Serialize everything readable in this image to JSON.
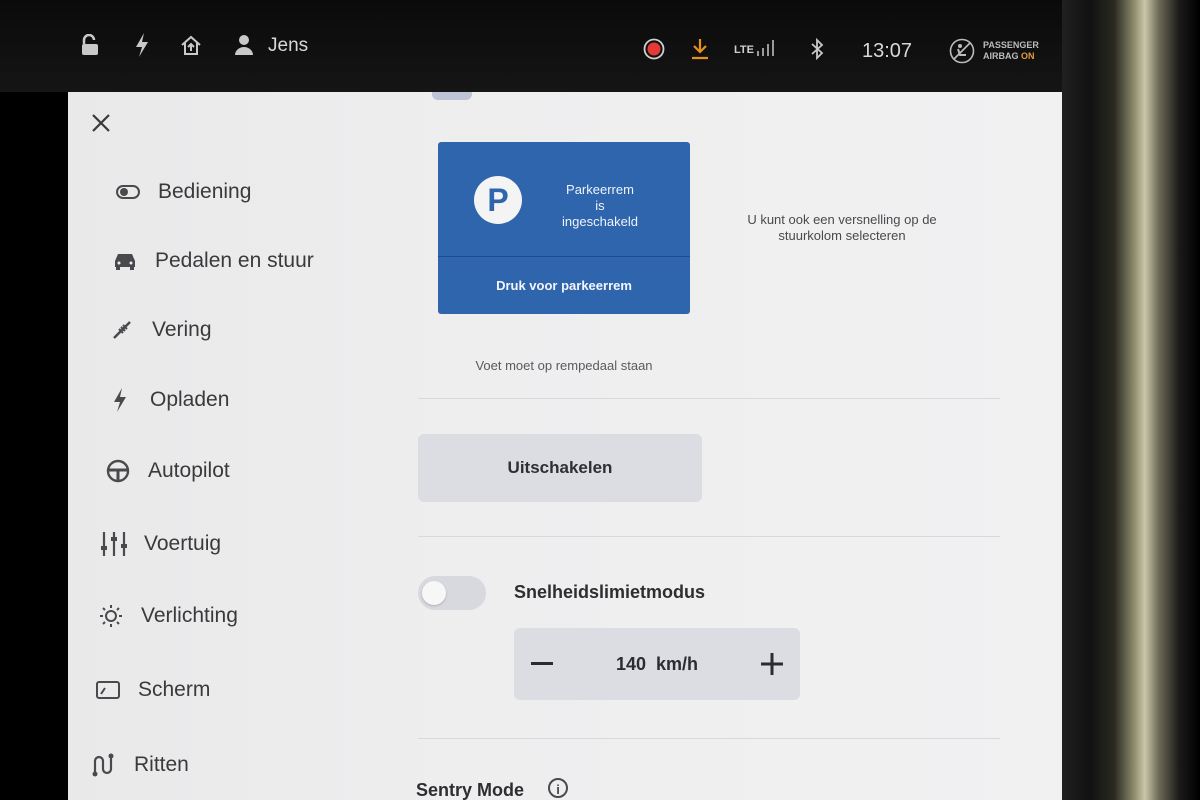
{
  "status_bar": {
    "driver_name": "Jens",
    "lte": "LTE",
    "time": "13:07",
    "airbag_line1": "PASSENGER",
    "airbag_line2": "AIRBAG",
    "airbag_state": "ON",
    "icons": [
      "lock-open-icon",
      "bolt-icon",
      "homelink-icon",
      "user-icon",
      "record-icon",
      "download-icon",
      "signal-icon",
      "bluetooth-icon",
      "airbag-icon"
    ],
    "colors": {
      "record": "#e53935",
      "download": "#e9901c",
      "airbag_on": "#e29a3c"
    }
  },
  "sidebar": {
    "items": [
      {
        "label": "Bediening",
        "icon": "toggle-icon"
      },
      {
        "label": "Pedalen en stuur",
        "icon": "car-icon"
      },
      {
        "label": "Vering",
        "icon": "suspension-icon"
      },
      {
        "label": "Opladen",
        "icon": "bolt-icon"
      },
      {
        "label": "Autopilot",
        "icon": "steering-wheel-icon"
      },
      {
        "label": "Voertuig",
        "icon": "sliders-icon"
      },
      {
        "label": "Verlichting",
        "icon": "light-icon"
      },
      {
        "label": "Scherm",
        "icon": "display-icon"
      },
      {
        "label": "Ritten",
        "icon": "trips-icon"
      }
    ]
  },
  "parking": {
    "status_line1": "Parkeerrem",
    "status_line2": "is",
    "status_line3": "ingeschakeld",
    "press_label": "Druk voor parkeerrem",
    "p_letter": "P",
    "hint_line1": "U kunt ook een versnelling op de",
    "hint_line2": "stuurkolom selecteren",
    "foot_note": "Voet moet op rempedaal staan",
    "color": "#2f65ad"
  },
  "disable_button": "Uitschakelen",
  "speed_limit": {
    "label": "Snelheidslimietmodus",
    "enabled": false,
    "value": "140",
    "unit": "km/h"
  },
  "sentry": {
    "label": "Sentry Mode"
  }
}
